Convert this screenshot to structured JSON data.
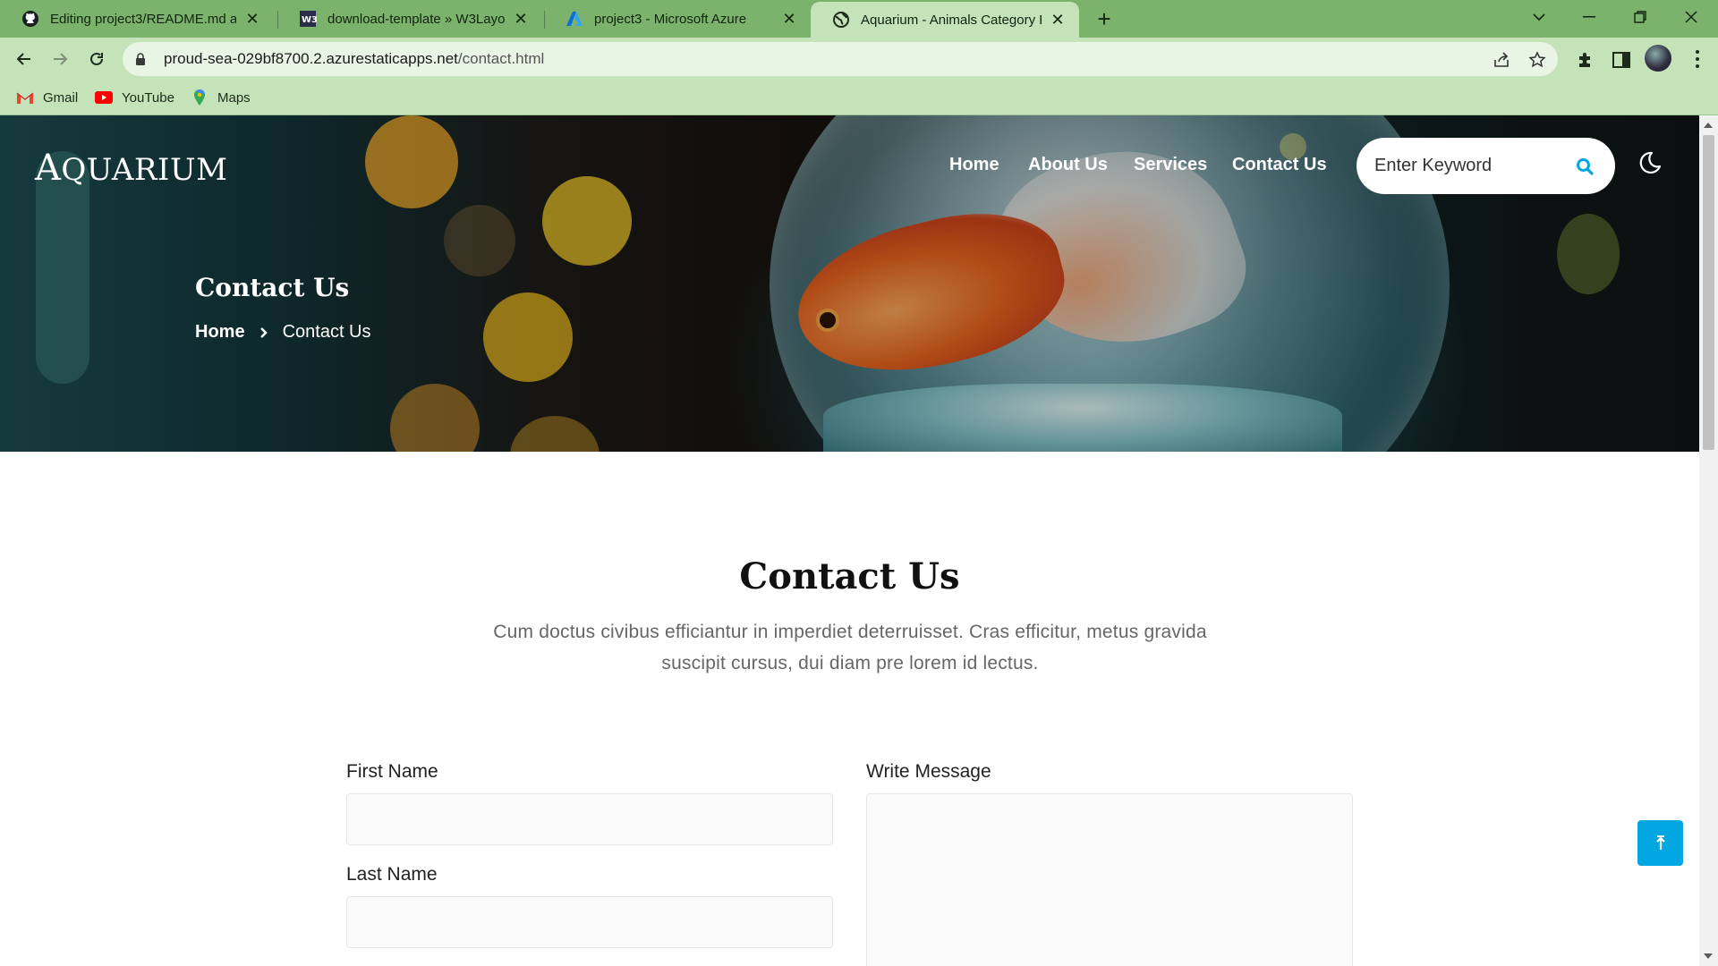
{
  "browser": {
    "tabs": [
      {
        "title": "Editing project3/README.md at m",
        "icon": "github-icon"
      },
      {
        "title": "download-template » W3Layouts",
        "icon": "w3layouts-icon"
      },
      {
        "title": "project3 - Microsoft Azure",
        "icon": "azure-icon"
      },
      {
        "title": "Aquarium - Animals Category Re",
        "icon": "globe-icon",
        "active": true
      }
    ],
    "new_tab": "+",
    "url": {
      "host": "proud-sea-029bf8700.2.azurestaticapps.net",
      "path": "/contact.html"
    },
    "bookmarks": [
      {
        "label": "Gmail",
        "icon": "gmail-icon"
      },
      {
        "label": "YouTube",
        "icon": "youtube-icon"
      },
      {
        "label": "Maps",
        "icon": "maps-icon"
      }
    ],
    "theme_color": "#7cb36c",
    "toolbar_color": "#c4e3b9"
  },
  "site": {
    "logo": {
      "initial": "A",
      "rest": "QUARIUM"
    },
    "nav": [
      "Home",
      "About Us",
      "Services",
      "Contact Us"
    ],
    "search": {
      "placeholder": "Enter Keyword"
    },
    "hero": {
      "title": "Contact Us",
      "breadcrumb": {
        "home": "Home",
        "current": "Contact Us"
      }
    },
    "section": {
      "title": "Contact Us",
      "subtitle": "Cum doctus civibus efficiantur in imperdiet deterruisset. Cras efficitur, metus gravida suscipit cursus, dui diam pre lorem id lectus."
    },
    "form": {
      "first_name_label": "First Name",
      "last_name_label": "Last Name",
      "message_label": "Write Message",
      "first_name_value": "",
      "last_name_value": "",
      "message_value": ""
    },
    "accent_color": "#02a7e2"
  }
}
